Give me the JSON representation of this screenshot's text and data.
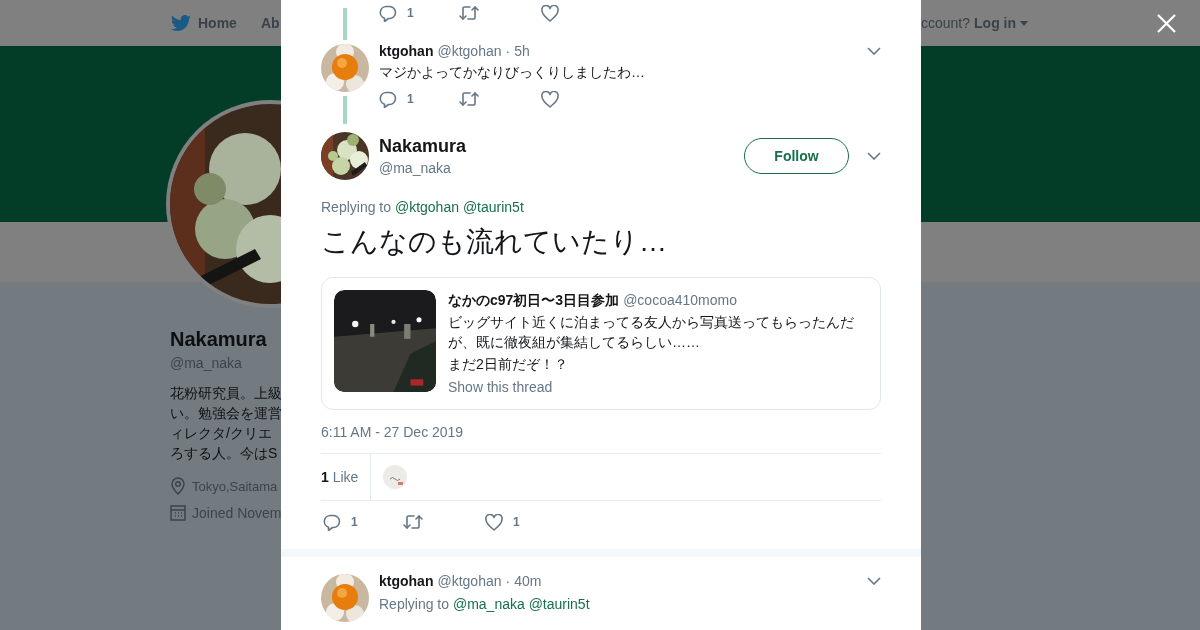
{
  "background_page": {
    "nav": {
      "items": [
        {
          "label": "Home"
        },
        {
          "label": "Ab"
        }
      ],
      "account_prompt": "ccount?",
      "login": "Log in"
    },
    "profile": {
      "name": "Nakamura",
      "handle": "@ma_naka",
      "bio": [
        "花粉研究員。上級",
        "い。勉強会を運営",
        "ィレクタ/クリエ",
        "ろする人。今はS"
      ],
      "location": "Tokyo,Saitama",
      "joined": "Joined Novem"
    }
  },
  "modal": {
    "previous_actions": {
      "replies": "1"
    },
    "parent_tweet": {
      "author": "ktgohan",
      "handle": "@ktgohan",
      "separator": "·",
      "time": "5h",
      "text": "マジかよってかなりびっくりしましたわ…",
      "replies": "1"
    },
    "main_tweet": {
      "author": "Nakamura",
      "handle": "@ma_naka",
      "follow_label": "Follow",
      "replying_prefix": "Replying to",
      "replying_to": [
        "@ktgohan",
        "@taurin5t"
      ],
      "text": "こんなのも流れていたり…",
      "quote": {
        "author": "なかのc97初日〜3日目参加",
        "handle": "@cocoa410momo",
        "paragraphs": [
          "ビッグサイト近くに泊まってる友人から写真送ってもらったんだが、既に徹夜組が集結してるらしい……",
          "まだ2日前だぞ！？"
        ],
        "show_thread": "Show this thread"
      },
      "timestamp": "6:11 AM - 27 Dec 2019",
      "likes": {
        "count": "1",
        "label": "Like"
      },
      "replies": "1",
      "like_count": "1"
    },
    "reply_tweet": {
      "author": "ktgohan",
      "handle": "@ktgohan",
      "separator": "·",
      "time": "40m",
      "replying_prefix": "Replying to",
      "replying_to": [
        "@ma_naka",
        "@taurin5t"
      ]
    }
  }
}
